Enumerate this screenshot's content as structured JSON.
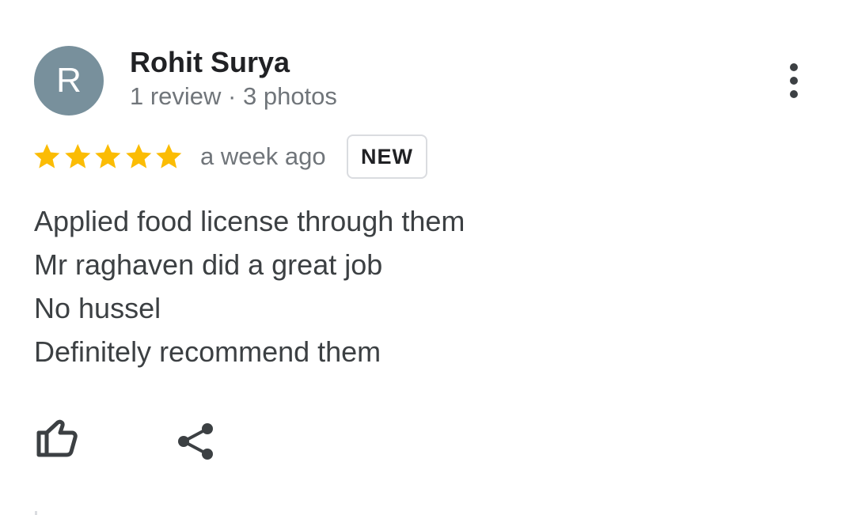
{
  "reviewer": {
    "avatar_initial": "R",
    "avatar_color": "#78909c",
    "name": "Rohit Surya",
    "meta": "1 review · 3 photos"
  },
  "menu": {
    "icon": "more-vert-icon"
  },
  "rating": {
    "stars": 5,
    "max_stars": 5,
    "star_color": "#fbbc04",
    "time_ago": "a week ago",
    "badge": "NEW"
  },
  "review": {
    "lines": [
      "Applied food license through them",
      "Mr raghaven did a great job",
      "No hussel",
      "Definitely recommend them"
    ]
  },
  "actions": {
    "like_icon": "thumb-up-icon",
    "share_icon": "share-icon"
  }
}
